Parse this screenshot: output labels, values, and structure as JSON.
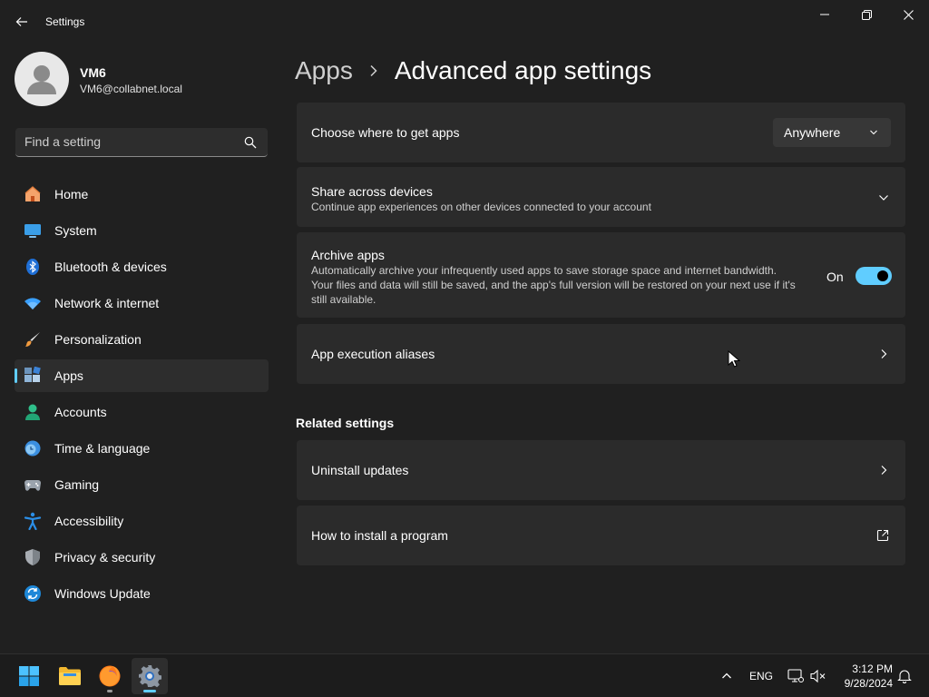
{
  "window": {
    "title": "Settings"
  },
  "profile": {
    "name": "VM6",
    "email": "VM6@collabnet.local"
  },
  "search": {
    "placeholder": "Find a setting"
  },
  "nav": {
    "items": [
      {
        "label": "Home",
        "icon": "home-icon"
      },
      {
        "label": "System",
        "icon": "system-icon"
      },
      {
        "label": "Bluetooth & devices",
        "icon": "bluetooth-icon"
      },
      {
        "label": "Network & internet",
        "icon": "wifi-icon"
      },
      {
        "label": "Personalization",
        "icon": "brush-icon"
      },
      {
        "label": "Apps",
        "icon": "apps-icon",
        "selected": true
      },
      {
        "label": "Accounts",
        "icon": "accounts-icon"
      },
      {
        "label": "Time & language",
        "icon": "time-language-icon"
      },
      {
        "label": "Gaming",
        "icon": "gaming-icon"
      },
      {
        "label": "Accessibility",
        "icon": "accessibility-icon"
      },
      {
        "label": "Privacy & security",
        "icon": "shield-icon"
      },
      {
        "label": "Windows Update",
        "icon": "windows-update-icon"
      }
    ]
  },
  "breadcrumb": {
    "parent": "Apps",
    "current": "Advanced app settings"
  },
  "settings": {
    "choose_apps": {
      "title": "Choose where to get apps",
      "value": "Anywhere"
    },
    "share_devices": {
      "title": "Share across devices",
      "description": "Continue app experiences on other devices connected to your account"
    },
    "archive_apps": {
      "title": "Archive apps",
      "description_line1": "Automatically archive your infrequently used apps to save storage space and internet bandwidth.",
      "description_line2": "Your files and data will still be saved, and the app's full version will be restored on your next use if it's",
      "description_line3": "still available.",
      "toggle_label": "On",
      "toggle_on": true
    },
    "execution_aliases": {
      "title": "App execution aliases"
    }
  },
  "related": {
    "header": "Related settings",
    "uninstall_updates": "Uninstall updates",
    "install_program": "How to install a program"
  },
  "taskbar": {
    "apps": [
      "windows-start-icon",
      "file-explorer-icon",
      "firefox-icon",
      "settings-gear-icon"
    ],
    "language": "ENG",
    "time": "3:12 PM",
    "date": "9/28/2024"
  },
  "colors": {
    "accent": "#60cdff",
    "background": "#202020",
    "card": "#2b2b2b"
  }
}
